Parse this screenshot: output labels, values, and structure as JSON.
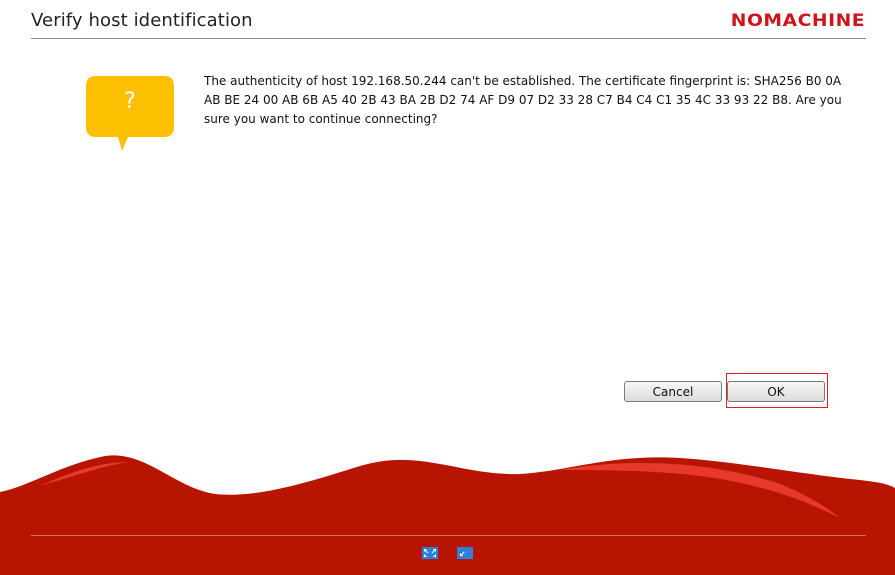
{
  "window": {
    "title": "Verify host identification",
    "brand": "NOMACHINE"
  },
  "dialog": {
    "icon": "question-bubble-icon",
    "icon_glyph": "?",
    "message": "The authenticity of host 192.168.50.244 can't be established. The certificate fingerprint is: SHA256 B0 0A AB BE 24 00 AB 6B A5 40 2B 43 BA 2B D2 74 AF D9 07 D2 33 28 C7 B4 C4 C1 35 4C 33 93 22 B8. Are you sure you want to continue connecting?"
  },
  "buttons": {
    "cancel_label": "Cancel",
    "ok_label": "OK"
  },
  "footer": {
    "icons": [
      "fullscreen-icon",
      "window-mode-icon"
    ]
  },
  "colors": {
    "brand_red": "#d0141b",
    "wave_red": "#b81402",
    "bubble_yellow": "#fdc000",
    "highlight_border": "#e02020",
    "footer_icon_blue": "#2f80d8"
  }
}
